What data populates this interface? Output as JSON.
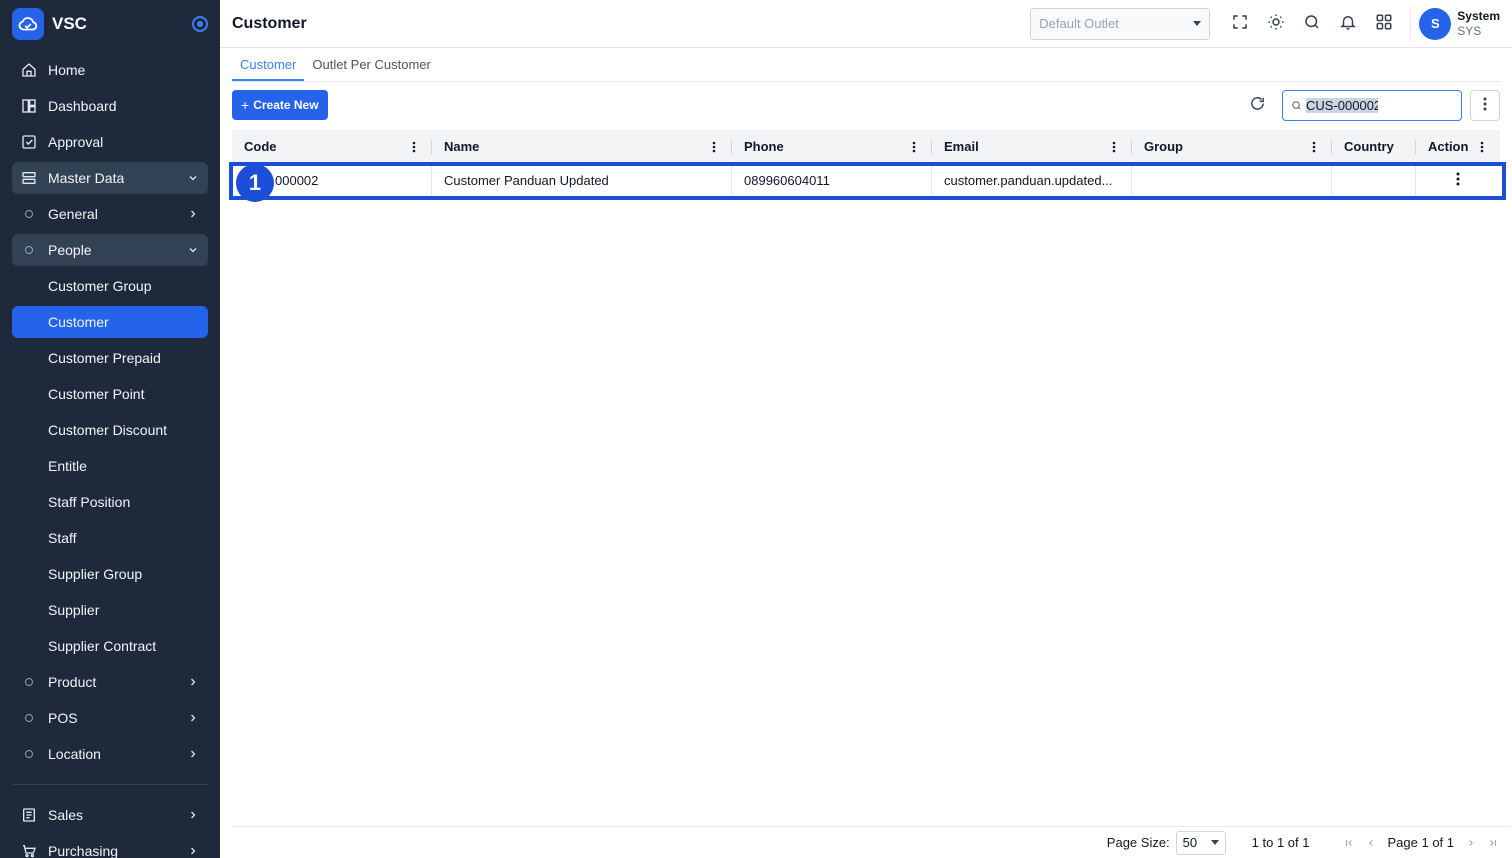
{
  "app": {
    "name": "VSC"
  },
  "sidebar": {
    "items": [
      {
        "label": "Home"
      },
      {
        "label": "Dashboard"
      },
      {
        "label": "Approval"
      },
      {
        "label": "Master Data"
      },
      {
        "label": "General"
      },
      {
        "label": "People"
      },
      {
        "label": "Customer Group"
      },
      {
        "label": "Customer"
      },
      {
        "label": "Customer Prepaid"
      },
      {
        "label": "Customer Point"
      },
      {
        "label": "Customer Discount"
      },
      {
        "label": "Entitle"
      },
      {
        "label": "Staff Position"
      },
      {
        "label": "Staff"
      },
      {
        "label": "Supplier Group"
      },
      {
        "label": "Supplier"
      },
      {
        "label": "Supplier Contract"
      },
      {
        "label": "Product"
      },
      {
        "label": "POS"
      },
      {
        "label": "Location"
      },
      {
        "label": "Sales"
      },
      {
        "label": "Purchasing"
      }
    ]
  },
  "header": {
    "title": "Customer",
    "outlet_placeholder": "Default Outlet",
    "user": {
      "initial": "S",
      "name": "System",
      "code": "SYS"
    }
  },
  "tabs": [
    {
      "label": "Customer"
    },
    {
      "label": "Outlet Per Customer"
    }
  ],
  "toolbar": {
    "create_label": "Create New",
    "search_value": "CUS-000002"
  },
  "grid": {
    "columns": [
      {
        "label": "Code"
      },
      {
        "label": "Name"
      },
      {
        "label": "Phone"
      },
      {
        "label": "Email"
      },
      {
        "label": "Group"
      },
      {
        "label": "Country"
      },
      {
        "label": "Action"
      }
    ],
    "rows": [
      {
        "code": "CUS-000002",
        "code_visible": "000002",
        "name": "Customer Panduan Updated",
        "phone": "089960604011",
        "email": "customer.panduan.updated...",
        "group": "",
        "country": ""
      }
    ]
  },
  "annotation": {
    "step": "1"
  },
  "footer": {
    "page_size_label": "Page Size:",
    "page_size": "50",
    "range_text": "1 to 1 of 1",
    "page_text": "Page 1 of 1"
  },
  "colors": {
    "sidebar_bg": "#1e293b",
    "accent": "#2563eb",
    "highlight": "#1d4ed8"
  }
}
